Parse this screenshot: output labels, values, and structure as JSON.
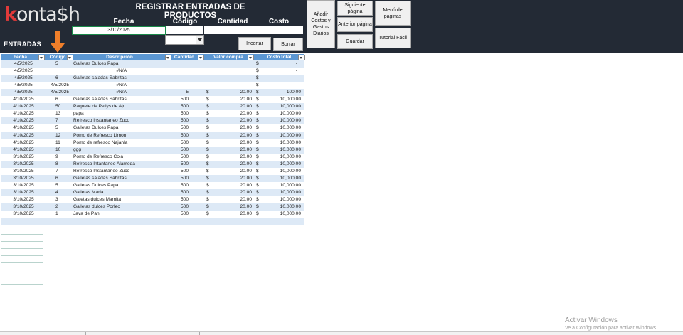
{
  "app": {
    "logo_text": "kontaSh",
    "title": "REGISTRAR ENTRADAS DE PRODUCTOS",
    "section_label": "ENTRADAS"
  },
  "form": {
    "headers": {
      "fecha": "Fecha",
      "codigo": "Código",
      "cantidad": "Cantidad",
      "costo": "Costo"
    },
    "fecha_value": "3/10/2025",
    "codigo_value": "",
    "cantidad_value": "",
    "costo_value": ""
  },
  "buttons": {
    "insertar": "Incertar",
    "borrar": "Borrar",
    "anadir_costos": "Añadir Costos y Gastos Diarios",
    "siguiente": "Siguiente página",
    "anterior": "Anterior página",
    "guardar": "Guardar",
    "menu": "Menú de páginas",
    "tutorial": "Tutorial Fácil"
  },
  "table": {
    "columns": [
      "Fecha",
      "Código",
      "Descripción",
      "Cantidad",
      "Valor compra",
      "Costo total"
    ],
    "currency_symbol": "$",
    "rows": [
      {
        "fecha": "4/5/2025",
        "codigo": "5",
        "desc": "Galletas Dulces Papa",
        "cant": "",
        "val": "",
        "cost": "-"
      },
      {
        "fecha": "4/5/2025",
        "codigo": "",
        "desc": "#N/A",
        "cant": "",
        "val": "",
        "cost": "-"
      },
      {
        "fecha": "4/5/2025",
        "codigo": "6",
        "desc": "Galletas saladas Sabritas",
        "cant": "",
        "val": "",
        "cost": "-"
      },
      {
        "fecha": "4/5/2025",
        "codigo": "4/5/2025",
        "desc": "#N/A",
        "cant": "",
        "val": "",
        "cost": "-"
      },
      {
        "fecha": "4/5/2025",
        "codigo": "4/5/2025",
        "desc": "#N/A",
        "cant": "5",
        "val": "20.00",
        "cost": "100.00"
      },
      {
        "fecha": "4/10/2025",
        "codigo": "6",
        "desc": "Galletas saladas Sabritas",
        "cant": "500",
        "val": "20.00",
        "cost": "10,000.00"
      },
      {
        "fecha": "4/10/2025",
        "codigo": "50",
        "desc": "Paquete de Pellys de Ajo",
        "cant": "500",
        "val": "20.00",
        "cost": "10,000.00"
      },
      {
        "fecha": "4/10/2025",
        "codigo": "13",
        "desc": "papa",
        "cant": "500",
        "val": "20.00",
        "cost": "10,000.00"
      },
      {
        "fecha": "4/10/2025",
        "codigo": "7",
        "desc": "Refresco Instantaneo Zuco",
        "cant": "500",
        "val": "20.00",
        "cost": "10,000.00"
      },
      {
        "fecha": "4/10/2025",
        "codigo": "5",
        "desc": "Galletas Dulces Papa",
        "cant": "500",
        "val": "20.00",
        "cost": "10,000.00"
      },
      {
        "fecha": "4/10/2025",
        "codigo": "12",
        "desc": "Pomo de Refresco Limon",
        "cant": "500",
        "val": "20.00",
        "cost": "10,000.00"
      },
      {
        "fecha": "4/10/2025",
        "codigo": "11",
        "desc": "Pomo de refresco Najanla",
        "cant": "500",
        "val": "20.00",
        "cost": "10,000.00"
      },
      {
        "fecha": "4/10/2025",
        "codigo": "10",
        "desc": "ggg",
        "cant": "500",
        "val": "20.00",
        "cost": "10,000.00"
      },
      {
        "fecha": "3/10/2025",
        "codigo": "9",
        "desc": "Pomo de Refresco Cola",
        "cant": "500",
        "val": "20.00",
        "cost": "10,000.00"
      },
      {
        "fecha": "3/10/2025",
        "codigo": "8",
        "desc": "Refresco Intantaneo Alameda",
        "cant": "500",
        "val": "20.00",
        "cost": "10,000.00"
      },
      {
        "fecha": "3/10/2025",
        "codigo": "7",
        "desc": "Refresco Instantaneo Zuco",
        "cant": "500",
        "val": "20.00",
        "cost": "10,000.00"
      },
      {
        "fecha": "3/10/2025",
        "codigo": "6",
        "desc": "Galletas saladas Sabritas",
        "cant": "500",
        "val": "20.00",
        "cost": "10,000.00"
      },
      {
        "fecha": "3/10/2025",
        "codigo": "5",
        "desc": "Galletas Dulces Papa",
        "cant": "500",
        "val": "20.00",
        "cost": "10,000.00"
      },
      {
        "fecha": "3/10/2025",
        "codigo": "4",
        "desc": "Galletas Maria",
        "cant": "500",
        "val": "20.00",
        "cost": "10,000.00"
      },
      {
        "fecha": "3/10/2025",
        "codigo": "3",
        "desc": "Galetas dulces Mamita",
        "cant": "500",
        "val": "20.00",
        "cost": "10,000.00"
      },
      {
        "fecha": "3/10/2025",
        "codigo": "2",
        "desc": "Galletas dulces Porleo",
        "cant": "500",
        "val": "20.00",
        "cost": "10,000.00"
      },
      {
        "fecha": "3/10/2025",
        "codigo": "1",
        "desc": "Java de Pan",
        "cant": "500",
        "val": "20.00",
        "cost": "10,000.00"
      }
    ]
  },
  "watermark": {
    "line1": "Activar Windows",
    "line2": "Ve a Configuración para activar Windows."
  },
  "colors": {
    "header_bg": "#232a35",
    "table_header": "#5b97d3",
    "row_alt": "#dde9f6",
    "logo_accent": "#e03a3a",
    "arrow": "#f07f2a"
  }
}
